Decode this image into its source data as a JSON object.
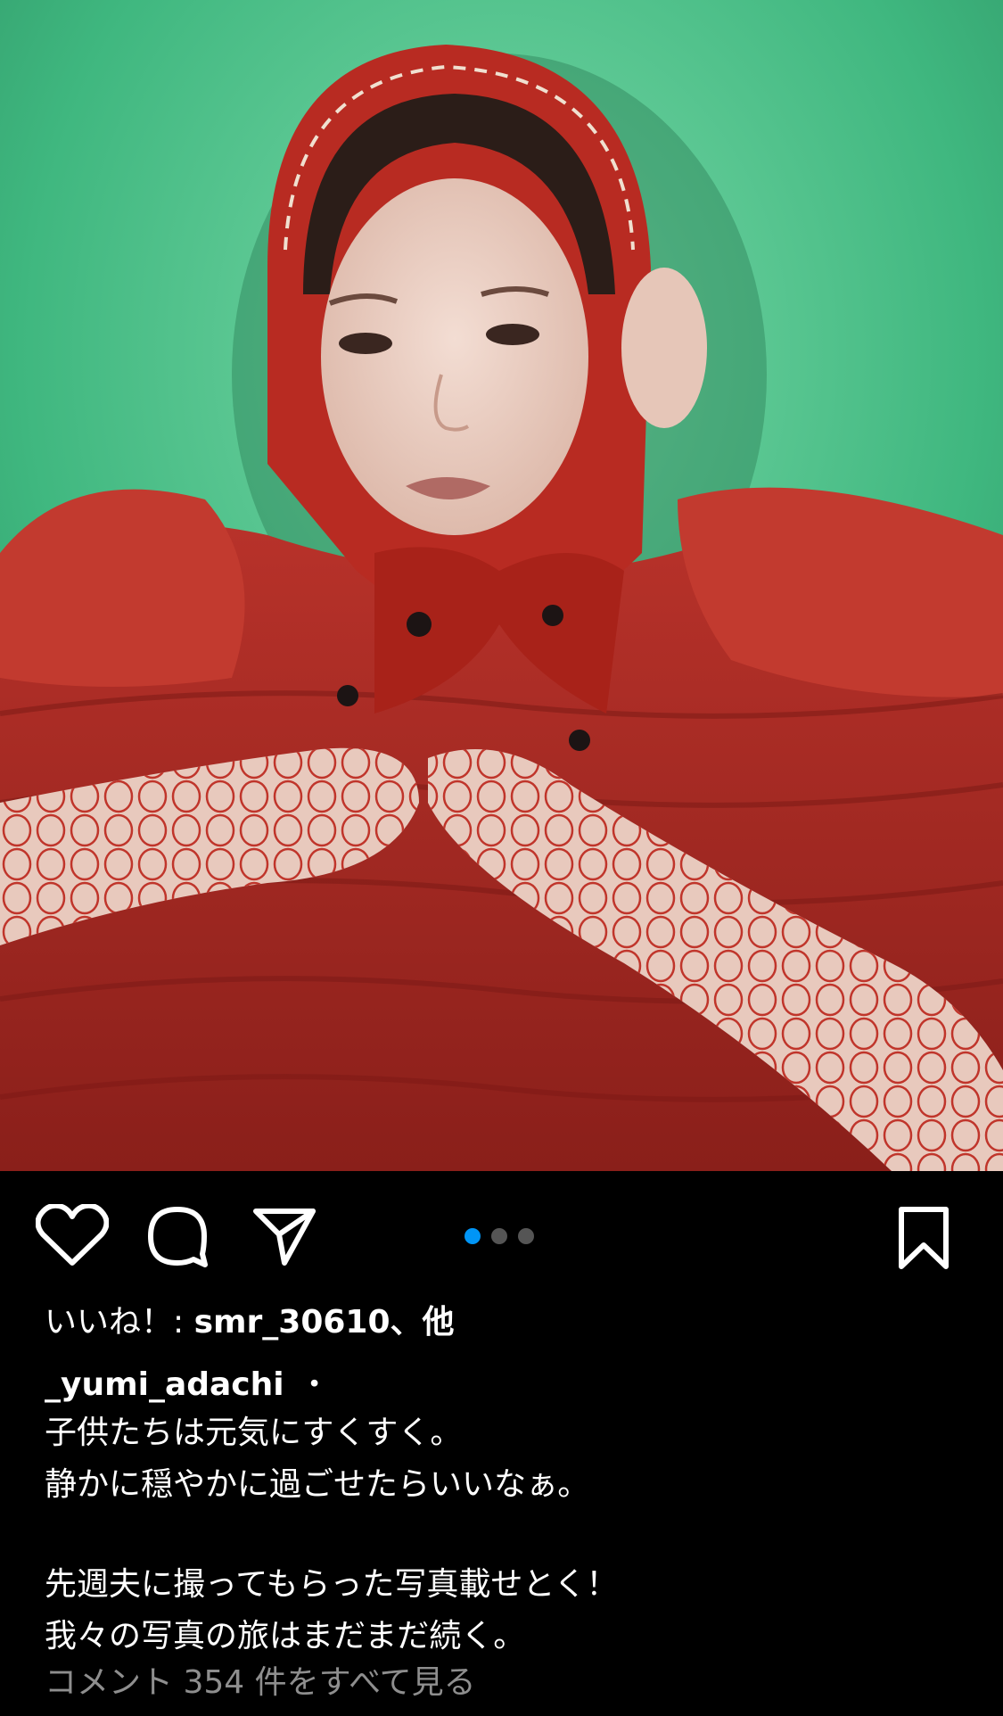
{
  "post": {
    "image_alt": "Woman in red headscarf and red ruffled dress against green backdrop",
    "carousel": {
      "total": 3,
      "active_index": 0,
      "active_color": "#0095f6",
      "inactive_color": "#555555"
    }
  },
  "actions": {
    "like_icon": "heart-icon",
    "comment_icon": "comment-bubble-icon",
    "share_icon": "paper-plane-icon",
    "save_icon": "bookmark-icon"
  },
  "likes": {
    "prefix": "いいね！: ",
    "user": "smr_30610",
    "suffix": "、他"
  },
  "caption": {
    "username": "_yumi_adachi",
    "separator": "・",
    "lines": [
      "子供たちは元気にすくすく。",
      "静かに穏やかに過ごせたらいいなぁ。",
      "先週夫に撮ってもらった写真載せとく！",
      "我々の写真の旅はまだまだ続く。"
    ]
  },
  "comments": {
    "view_all": "コメント 354 件をすべて見る"
  }
}
